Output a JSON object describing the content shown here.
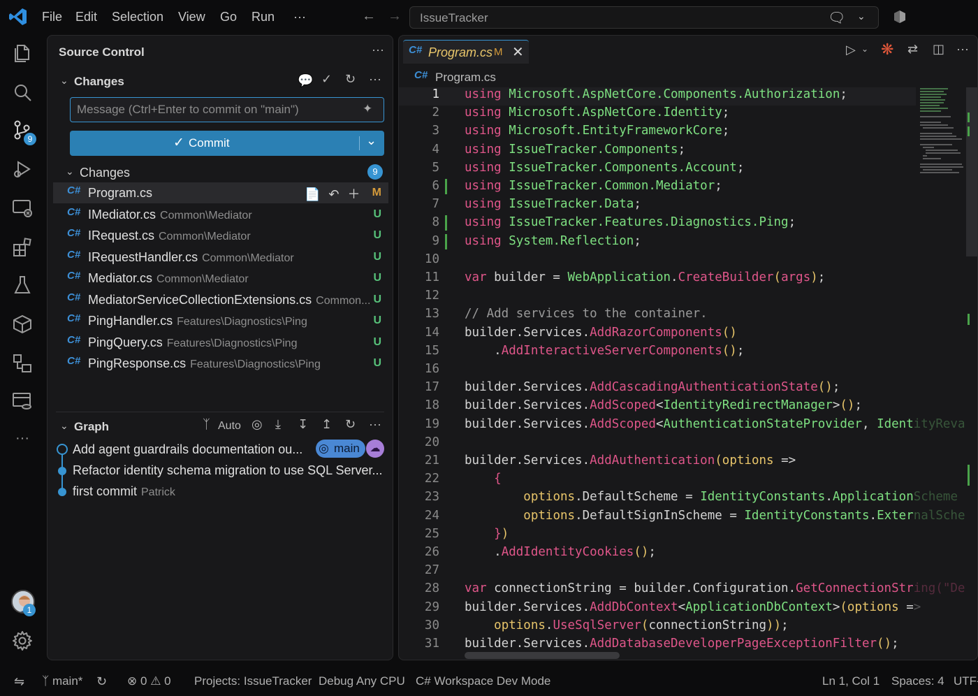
{
  "colors": {
    "accent": "#3794d2",
    "commit_button": "#2b80b4",
    "added": "#4aa34a",
    "untracked": "#57c27a",
    "modified": "#d49a3a"
  },
  "menu": [
    "File",
    "Edit",
    "Selection",
    "View",
    "Go",
    "Run",
    "···"
  ],
  "command_center": {
    "text": "IssueTracker"
  },
  "activity": {
    "scm_badge": "9",
    "account_badge": "1"
  },
  "source_control": {
    "title": "Source Control",
    "more": "···",
    "changes_header": "Changes",
    "message_placeholder": "Message (Ctrl+Enter to commit on \"main\")",
    "commit_label": "Commit",
    "changes_group": "Changes",
    "changes_count": "9",
    "files": [
      {
        "name": "Program.cs",
        "path": "",
        "status": "M"
      },
      {
        "name": "IMediator.cs",
        "path": "Common\\Mediator",
        "status": "U"
      },
      {
        "name": "IRequest.cs",
        "path": "Common\\Mediator",
        "status": "U"
      },
      {
        "name": "IRequestHandler.cs",
        "path": "Common\\Mediator",
        "status": "U"
      },
      {
        "name": "Mediator.cs",
        "path": "Common\\Mediator",
        "status": "U"
      },
      {
        "name": "MediatorServiceCollectionExtensions.cs",
        "path": "Common...",
        "status": "U"
      },
      {
        "name": "PingHandler.cs",
        "path": "Features\\Diagnostics\\Ping",
        "status": "U"
      },
      {
        "name": "PingQuery.cs",
        "path": "Features\\Diagnostics\\Ping",
        "status": "U"
      },
      {
        "name": "PingResponse.cs",
        "path": "Features\\Diagnostics\\Ping",
        "status": "U"
      }
    ]
  },
  "graph": {
    "title": "Graph",
    "auto_label": "Auto",
    "commits": [
      {
        "message": "Add agent guardrails documentation ou...",
        "author": "",
        "branch": "main"
      },
      {
        "message": "Refactor identity schema migration to use SQL Server...",
        "author": ""
      },
      {
        "message": "first commit",
        "author": "Patrick"
      }
    ]
  },
  "editor": {
    "tab": {
      "name": "Program.cs",
      "status": "M"
    },
    "breadcrumb": "Program.cs",
    "lines": [
      "1",
      "2",
      "3",
      "4",
      "5",
      "6",
      "7",
      "8",
      "9",
      "10",
      "11",
      "12",
      "13",
      "14",
      "15",
      "16",
      "17",
      "18",
      "19",
      "20",
      "21",
      "22",
      "23",
      "24",
      "25",
      "26",
      "27",
      "28",
      "29",
      "30",
      "31"
    ]
  },
  "statusbar": {
    "branch": "main*",
    "errors": "0",
    "warnings": "0",
    "projects": "Projects: IssueTracker",
    "config": "Debug Any CPU",
    "mode": "C# Workspace Dev Mode",
    "position": "Ln 1, Col 1",
    "spaces": "Spaces: 4",
    "encoding": "UTF-"
  }
}
